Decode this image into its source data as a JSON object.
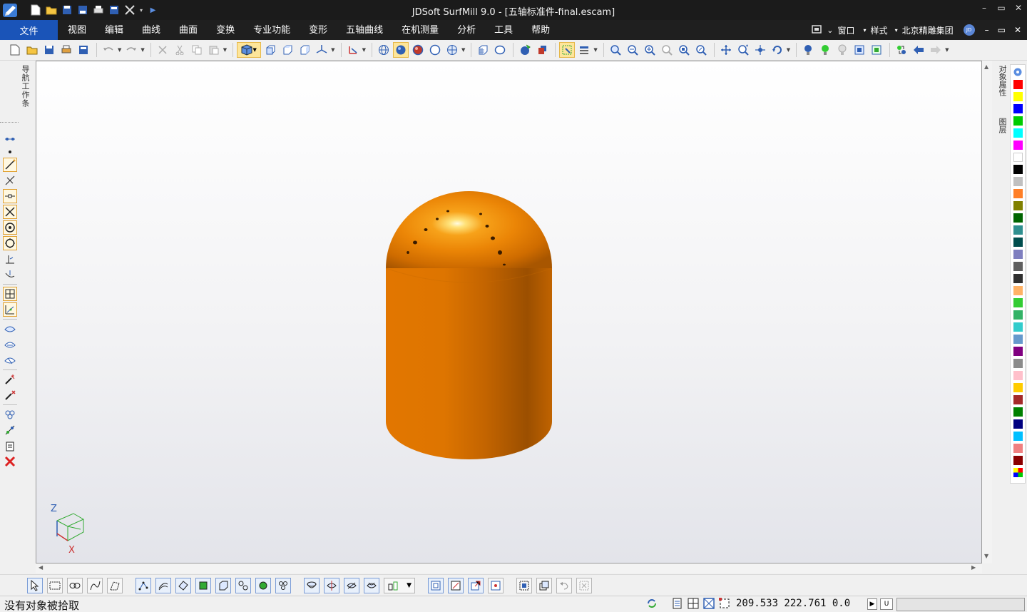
{
  "app": {
    "title": "JDSoft SurfMill 9.0 - [五轴标准件-final.escam]",
    "win_minimize": "–",
    "win_restore": "▭",
    "win_close": "✕"
  },
  "menu": {
    "file_tab": "文件",
    "items": [
      "视图",
      "编辑",
      "曲线",
      "曲面",
      "变换",
      "专业功能",
      "变形",
      "五轴曲线",
      "在机测量",
      "分析",
      "工具",
      "帮助"
    ],
    "right": {
      "window_label": "窗口",
      "style_label": "样式",
      "company_label": "北京精雕集团",
      "user_badge": "JD"
    }
  },
  "left_panel": {
    "nav_tab_label": "导航工作条"
  },
  "right_panel": {
    "tab_object_props": "对象属性",
    "tab_layers": "图层",
    "palette": [
      "#ff0000",
      "#ffff00",
      "#0000ff",
      "#00cc00",
      "#00ffff",
      "#ff00ff",
      "#ffffff",
      "#000000",
      "#c0c0c0",
      "#ff7f27",
      "#808000",
      "#006400",
      "#2f8f8f",
      "#004d4d",
      "#7f7fbf",
      "#606060",
      "#303030",
      "#ffb266",
      "#33cc33",
      "#33b266",
      "#33cccc",
      "#6699cc",
      "#800080",
      "#8c8c8c",
      "#ffc0cb",
      "#ffcc00",
      "#a52a2a",
      "#008000",
      "#000080",
      "#00bfff",
      "#f08080",
      "#8b0000",
      "#multi"
    ]
  },
  "viewport": {
    "axis_z": "Z",
    "axis_x": "X",
    "model_color": "#e87a00"
  },
  "status": {
    "message": "没有对象被拾取",
    "coords": "209.533  222.761  0.0",
    "u_button": "U"
  }
}
